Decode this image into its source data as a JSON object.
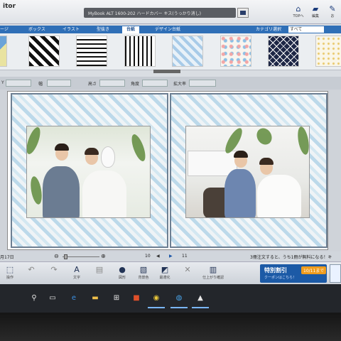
{
  "app": {
    "logo": "itor"
  },
  "document": {
    "name": "MyBook ALT 1600-202 ハードカバー キス(うっかり消し)"
  },
  "top_icons": [
    {
      "icon": "home-icon",
      "label": "TOPへ"
    },
    {
      "icon": "folder-icon",
      "label": "編集"
    },
    {
      "icon": "pen-icon",
      "label": "お"
    }
  ],
  "tabs": [
    "ージ",
    "ボックス",
    "イラスト",
    "型抜き",
    "台紙",
    "デザイン台紙"
  ],
  "active_tab": "台紙",
  "category_select": {
    "label": "カテゴリ選択",
    "value": "すべて"
  },
  "props": {
    "y": "Y",
    "width": "幅",
    "height": "高さ",
    "angle": "角度",
    "zoom": "拡大率"
  },
  "status": {
    "date": "月17日",
    "page_left": "10",
    "page_right": "11",
    "notice": "3冊注文すると、うち1冊が無料になる！キ"
  },
  "tools": [
    {
      "label": "操作",
      "icon": "cursor-icon"
    },
    {
      "label": "",
      "icon": "undo-icon"
    },
    {
      "label": "",
      "icon": "redo-icon"
    },
    {
      "label": "文字",
      "icon": "text-icon"
    },
    {
      "label": "",
      "icon": "image-icon"
    },
    {
      "label": "図形",
      "icon": "shape-icon"
    },
    {
      "label": "背景色",
      "icon": "background-icon"
    },
    {
      "label": "最適化",
      "icon": "optimize-icon"
    },
    {
      "label": "",
      "icon": "delete-icon"
    },
    {
      "label": "仕上がり確認",
      "icon": "preview-icon"
    }
  ],
  "sale": {
    "title": "特別割引",
    "subtitle": "クーポンはこちら！",
    "badge": "10/11まで"
  },
  "taskbar": [
    "search-icon",
    "task-view-icon",
    "edge-icon",
    "file-explorer-icon",
    "store-icon",
    "office-icon",
    "chrome-icon",
    "photo-editor-icon",
    "photos-icon"
  ]
}
